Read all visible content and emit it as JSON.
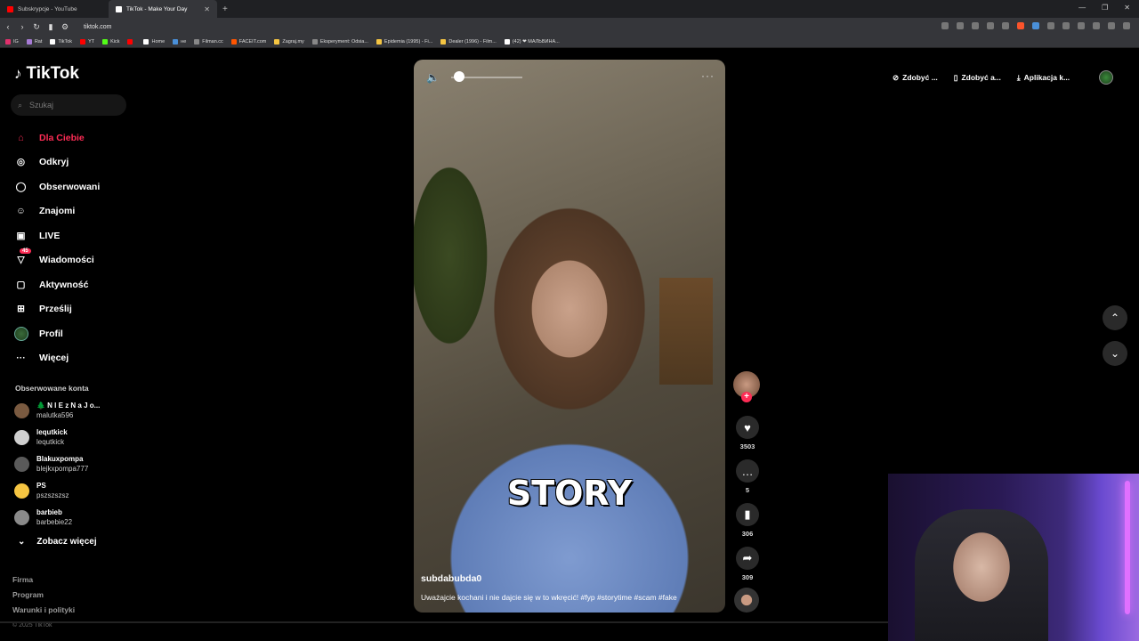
{
  "browser": {
    "tabs": [
      {
        "title": "Subskrypcje - YouTube",
        "color": "#ff0000",
        "active": false
      },
      {
        "title": "TikTok - Make Your Day",
        "color": "#ffffff",
        "active": true
      }
    ],
    "new_tab": "+",
    "url": "tiktok.com",
    "bookmarks": [
      {
        "label": "IG",
        "color": "#e1306c"
      },
      {
        "label": "Rat",
        "color": "#a77bd6"
      },
      {
        "label": "TikTok",
        "color": "#ffffff"
      },
      {
        "label": "YT",
        "color": "#ff0000"
      },
      {
        "label": "Kick",
        "color": "#53fc18"
      },
      {
        "label": "",
        "color": "#ff0000"
      },
      {
        "label": "Home",
        "color": "#ffffff"
      },
      {
        "label": "не",
        "color": "#4a90d9"
      },
      {
        "label": "Filman.cc",
        "color": "#888888"
      },
      {
        "label": "FACEIT.com",
        "color": "#ff5500"
      },
      {
        "label": "Zagraj.my",
        "color": "#f5c542"
      },
      {
        "label": "Eksperyment: Odsia...",
        "color": "#888888"
      },
      {
        "label": "Epidemia (1995) - Fi...",
        "color": "#f5c542"
      },
      {
        "label": "Dealer (1996) - Film...",
        "color": "#f5c542"
      },
      {
        "label": "(42) ❤ МАЛЬВИНА...",
        "color": "#ffffff"
      }
    ]
  },
  "tiktok": {
    "logo": "TikTok",
    "search_placeholder": "Szukaj",
    "nav": [
      {
        "label": "Dla Ciebie",
        "icon": "home-icon",
        "glyph": "⌂",
        "active": true
      },
      {
        "label": "Odkryj",
        "icon": "compass-icon",
        "glyph": "◎",
        "active": false
      },
      {
        "label": "Obserwowani",
        "icon": "following-icon",
        "glyph": "◯",
        "active": false
      },
      {
        "label": "Znajomi",
        "icon": "friends-icon",
        "glyph": "☺",
        "active": false
      },
      {
        "label": "LIVE",
        "icon": "live-icon",
        "glyph": "▣",
        "active": false
      },
      {
        "label": "Wiadomości",
        "icon": "messages-icon",
        "glyph": "▽",
        "active": false,
        "badge": "45"
      },
      {
        "label": "Aktywność",
        "icon": "activity-icon",
        "glyph": "▢",
        "active": false
      },
      {
        "label": "Prześlij",
        "icon": "upload-icon",
        "glyph": "⊞",
        "active": false
      },
      {
        "label": "Profil",
        "icon": "profile-icon",
        "glyph": "",
        "active": false
      },
      {
        "label": "Więcej",
        "icon": "more-icon",
        "glyph": "···",
        "active": false
      }
    ],
    "following_title": "Obserwowane konta",
    "accounts": [
      {
        "name": "🌲 N I E z N a J o...",
        "user": "malutka596",
        "color": "#7a5a40"
      },
      {
        "name": "lequtkick",
        "user": "lequtkick",
        "color": "#cfcfcf"
      },
      {
        "name": "Blakuxpompa",
        "user": "blejkxpompa777",
        "color": "#5a5a5a"
      },
      {
        "name": "PS",
        "user": "pszszszsz",
        "color": "#f5c542"
      },
      {
        "name": "barbieb",
        "user": "barbebie22",
        "color": "#8a8a8a"
      }
    ],
    "see_more": "Zobacz więcej",
    "footer": [
      "Firma",
      "Program",
      "Warunki i polityki"
    ],
    "copyright": "© 2025 TikTok"
  },
  "video": {
    "overlay_text": "STORY",
    "author": "subdabubda0",
    "description": "Uważajcie kochani i nie dajcie się w to wkręcić! #fyp #storytime #scam #fake",
    "volume_fraction": 0.05,
    "likes": "3503",
    "comments": "5",
    "saves": "306",
    "shares": "309"
  },
  "top_buttons": [
    {
      "label": "Zdobyć ...",
      "icon": "coin-icon",
      "glyph": "⊘"
    },
    {
      "label": "Zdobyć a...",
      "icon": "phone-icon",
      "glyph": "▯"
    },
    {
      "label": "Aplikacja k...",
      "icon": "download-icon",
      "glyph": "⤓"
    }
  ],
  "accent": "#fe2c55"
}
